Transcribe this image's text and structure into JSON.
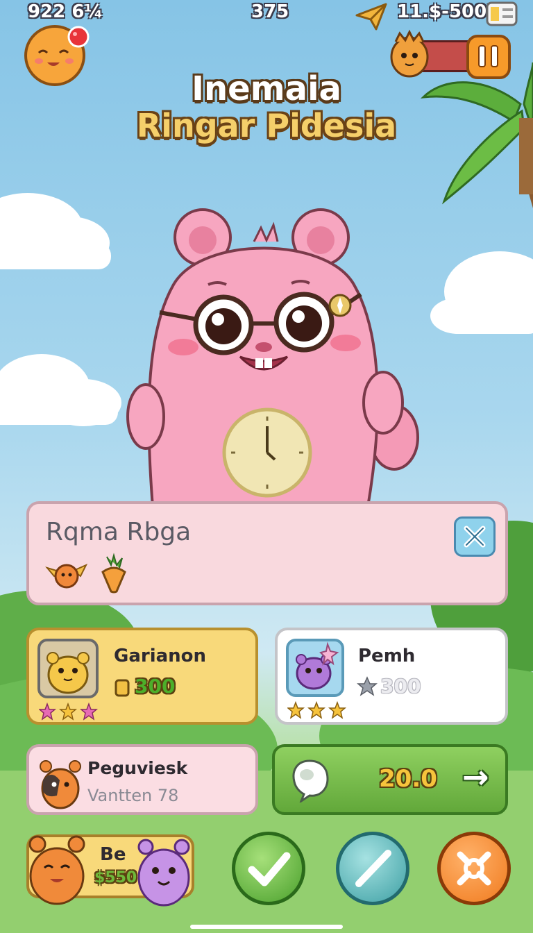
{
  "hud": {
    "top_left_value": "922 6¼",
    "top_center_value": "375",
    "top_right_value": "11.$-5002"
  },
  "title": {
    "line1": "Inemaia",
    "line2": "Ringar Pidesia"
  },
  "info_panel": {
    "name": "Rqma Rbga"
  },
  "cards": [
    {
      "name": "Garianon",
      "price": "300",
      "stars": 3,
      "price_color": "#4caf2a"
    },
    {
      "name": "Pemh",
      "price": "300",
      "stars": 3,
      "price_color": "#e8e8ee"
    }
  ],
  "peguviesk": {
    "name": "Peguviesk",
    "sub": "Vantten 78"
  },
  "buy_button": {
    "value": "20.0",
    "arrow": "→"
  },
  "bottom_badge": {
    "label": "Be",
    "price": "$550"
  },
  "colors": {
    "pink_body": "#f7a6c0",
    "gold_card": "#f8d97a",
    "green_button": "#7cc150",
    "orange_button": "#f5882a",
    "teal_button": "#5ab7b7"
  },
  "icons": [
    "pet-avatar-icon",
    "notification-dot-icon",
    "paper-plane-icon",
    "inventory-icon",
    "pause-icon",
    "close-icon",
    "check-icon",
    "edit-icon",
    "settings-icon",
    "arrow-right-icon",
    "star-icon",
    "coin-icon"
  ]
}
